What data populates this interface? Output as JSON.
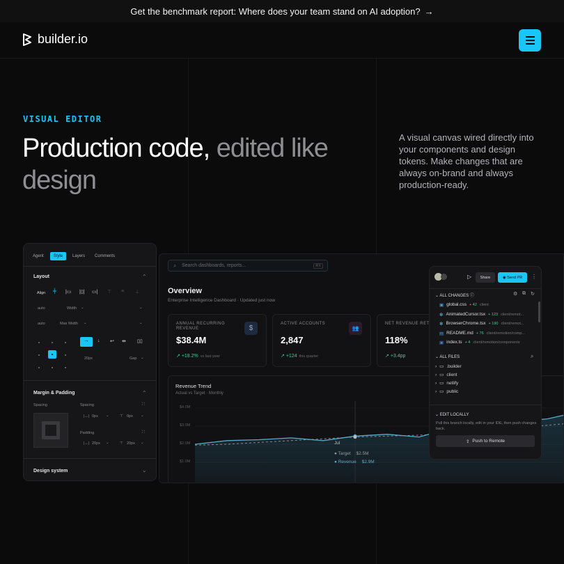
{
  "banner": {
    "text": "Get the benchmark report: Where does your team stand on AI adoption?",
    "arrow": "→"
  },
  "nav": {
    "logo": "builder.io"
  },
  "hero": {
    "eyebrow": "VISUAL EDITOR",
    "title_white": "Production code,",
    "title_gray": "edited like design",
    "description": "A visual canvas wired directly into your components and design tokens. Make changes that are always on-brand and always production-ready."
  },
  "left_panel": {
    "tabs": [
      "Agent",
      "Style",
      "Layers",
      "Comments"
    ],
    "active_tab": "Style",
    "layout": {
      "heading": "Layout",
      "align_label": "Align",
      "width_value": "auto",
      "width_label": "Width",
      "maxwidth_value": "auto",
      "maxwidth_label": "Max Width",
      "gap_value": "20px",
      "gap_label": "Gap"
    },
    "margin": {
      "heading": "Margin & Padding",
      "spacing_label": "Spacing",
      "spacing2_label": "Spacing",
      "padding_label": "Padding",
      "m1": "0px",
      "m2": "0px",
      "p1": "20px",
      "p2": "20px"
    },
    "design_system": "Design system"
  },
  "dashboard": {
    "search_placeholder": "Search dashboards, reports...",
    "kbd": "⌘K",
    "title": "Overview",
    "subtitle": "Enterprise Intelligence Dashboard · Updated just now",
    "cards": [
      {
        "label": "ANNUAL RECURRING REVENUE",
        "value": "$38.4M",
        "delta": "+18.2%",
        "note": "vs last year",
        "icon": "$"
      },
      {
        "label": "ACTIVE ACCOUNTS",
        "value": "2,847",
        "delta": "+124",
        "note": "this quarter",
        "icon": "👥"
      },
      {
        "label": "NET REVENUE RETE",
        "value": "118%",
        "delta": "+3.4pp",
        "note": "",
        "icon": ""
      }
    ],
    "chart": {
      "title": "Revenue Trend",
      "subtitle": "Actual vs Target · Monthly",
      "tooltip_month": "Jul",
      "target_label": "Target",
      "target_value": "$2.5M",
      "revenue_label": "Revenue",
      "revenue_value": "$2.9M"
    }
  },
  "chart_data": {
    "type": "line",
    "title": "Revenue Trend",
    "subtitle": "Actual vs Target · Monthly",
    "y_ticks": [
      "$4.0M",
      "$3.0M",
      "$2.0M",
      "$1.0M"
    ],
    "ylim": [
      1.0,
      4.0
    ],
    "x": [
      0,
      1,
      2,
      3,
      4,
      5,
      6,
      7,
      8,
      9,
      10,
      11,
      12
    ],
    "series": [
      {
        "name": "Revenue",
        "values": [
          2.0,
          2.2,
          2.25,
          2.35,
          2.2,
          2.45,
          2.55,
          2.4,
          2.9,
          3.0,
          3.25,
          3.4,
          3.8
        ]
      },
      {
        "name": "Target",
        "values": [
          1.95,
          2.0,
          2.1,
          2.2,
          2.3,
          2.4,
          2.45,
          2.5,
          2.6,
          2.75,
          2.9,
          3.05,
          3.2
        ]
      }
    ],
    "colors": {
      "Revenue": "#5aa9c7",
      "Target": "#8a8a90"
    }
  },
  "right_panel": {
    "share": "Share",
    "send_pr": "Send PR",
    "all_changes": "ALL CHANGES",
    "files": [
      {
        "name": "global.css",
        "plus": "+ 42",
        "path": "client"
      },
      {
        "name": "AnimatedCursor.tsx",
        "plus": "+ 123",
        "path": "client/remot..."
      },
      {
        "name": "BrowserChrome.tsx",
        "plus": "+ 190",
        "path": "client/remot..."
      },
      {
        "name": "README.md",
        "plus": "+ 76",
        "path": "client/remotion/comp..."
      },
      {
        "name": "index.ts",
        "plus": "+ 4",
        "path": "client/remotion/components"
      }
    ],
    "all_files": "ALL FILES",
    "folders": [
      ".builder",
      "client",
      "netlify",
      "public"
    ],
    "edit_locally": "EDIT LOCALLY",
    "edit_desc": "Pull this branch locally, edit in your IDE, then push changes back.",
    "push": "Push to Remote"
  }
}
